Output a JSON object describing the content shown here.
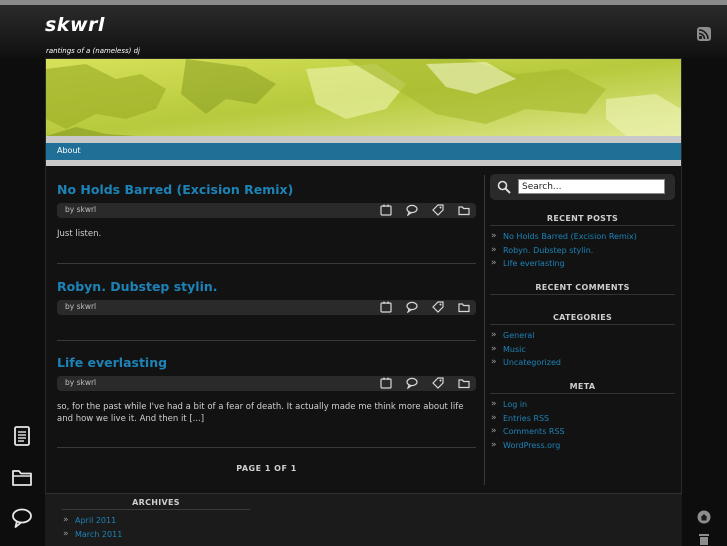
{
  "site": {
    "title": "skwrl",
    "tagline": "rantings of a (nameless) dj"
  },
  "nav": {
    "items": [
      {
        "label": "About"
      }
    ]
  },
  "posts": [
    {
      "title": "No Holds Barred (Excision Remix)",
      "byline": "by skwrl",
      "excerpt": "Just listen."
    },
    {
      "title": "Robyn. Dubstep stylin.",
      "byline": "by skwrl",
      "excerpt": ""
    },
    {
      "title": "Life everlasting",
      "byline": "by skwrl",
      "excerpt": "so, for the past while I've had a bit of a fear of death. It actually made me think more about life and how we live it. And then it [...]"
    }
  ],
  "pager": {
    "label": "PAGE 1 OF 1"
  },
  "sidebar": {
    "search": {
      "value": "Search..."
    },
    "recent_posts": {
      "title": "RECENT POSTS",
      "items": [
        "No Holds Barred (Excision Remix)",
        "Robyn. Dubstep stylin.",
        "Life everlasting"
      ]
    },
    "recent_comments": {
      "title": "RECENT COMMENTS"
    },
    "categories": {
      "title": "CATEGORIES",
      "items": [
        "General",
        "Music",
        "Uncategorized"
      ]
    },
    "meta": {
      "title": "META",
      "items": [
        "Log in",
        "Entries RSS",
        "Comments RSS",
        "WordPress.org"
      ]
    }
  },
  "archives": {
    "title": "ARCHIVES",
    "items": [
      "April 2011",
      "March 2011"
    ]
  },
  "colors": {
    "link": "#1d83b7",
    "nav": "#1f6f97",
    "banner": "#c8d64a"
  },
  "icons": [
    "rss-icon",
    "calendar-icon",
    "comment-icon",
    "tag-icon",
    "folder-icon",
    "search-icon",
    "document-icon",
    "home-icon"
  ]
}
